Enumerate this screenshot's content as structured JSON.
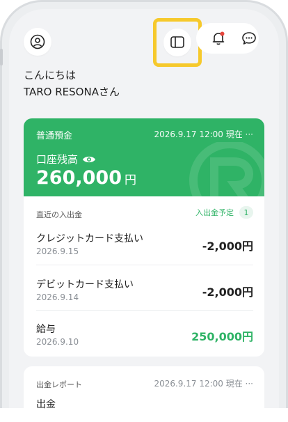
{
  "header": {
    "icons": [
      "user-icon",
      "book-icon",
      "bell-icon",
      "chat-icon"
    ]
  },
  "greeting": {
    "line1": "こんにちは",
    "line2": "TARO RESONAさん"
  },
  "account": {
    "type": "普通預金",
    "timestamp": "2026.9.17 12:00 現在 ···",
    "balance_label": "口座残高",
    "balance": "260,000",
    "unit": "円",
    "color": "#2fb366"
  },
  "transactions": {
    "header": "直近の入出金",
    "scheduled_label": "入出金予定",
    "scheduled_count": "1",
    "items": [
      {
        "name": "クレジットカード支払い",
        "date": "2026.9.15",
        "amount": "-2,000円"
      },
      {
        "name": "デビットカード支払い",
        "date": "2026.9.14",
        "amount": "-2,000円"
      },
      {
        "name": "給与",
        "date": "2026.9.10",
        "amount": "250,000円"
      }
    ]
  },
  "report": {
    "title": "出金レポート",
    "timestamp": "2026.9.17 12:00 現在 ···",
    "subtitle": "出金"
  },
  "highlight_color": "#f6c92c"
}
